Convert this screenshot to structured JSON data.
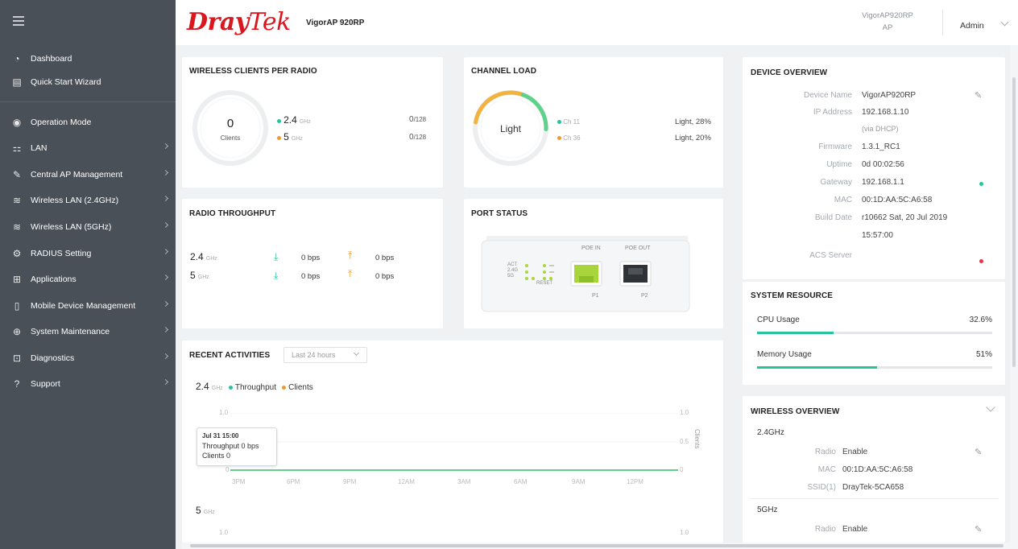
{
  "sidebar": {
    "items": [
      {
        "label": "Dashboard",
        "icon": "dashboard-icon"
      },
      {
        "label": "Quick Start Wizard",
        "icon": "wizard-icon"
      },
      {
        "label": "Operation Mode",
        "icon": "operation-mode-icon"
      },
      {
        "label": "LAN",
        "icon": "lan-icon"
      },
      {
        "label": "Central AP Management",
        "icon": "wrench-icon"
      },
      {
        "label": "Wireless LAN (2.4GHz)",
        "icon": "wifi-icon"
      },
      {
        "label": "Wireless LAN (5GHz)",
        "icon": "wifi-icon"
      },
      {
        "label": "RADIUS Setting",
        "icon": "gear-icon"
      },
      {
        "label": "Applications",
        "icon": "applications-icon"
      },
      {
        "label": "Mobile Device Management",
        "icon": "mobile-icon"
      },
      {
        "label": "System Maintenance",
        "icon": "maintenance-icon"
      },
      {
        "label": "Diagnostics",
        "icon": "diagnostics-icon"
      },
      {
        "label": "Support",
        "icon": "help-icon"
      }
    ]
  },
  "header": {
    "logo_dray": "Dray",
    "logo_tek": "Tek",
    "model": "VigorAP 920RP",
    "device_name": "VigorAP920RP",
    "device_mode": "AP",
    "user": "Admin"
  },
  "wireless_clients": {
    "title": "WIRELESS CLIENTS PER RADIO",
    "total": "0",
    "total_label": "Clients",
    "band24": "2.4",
    "band5": "5",
    "ghz": "GHz",
    "count24": "0",
    "max24": "/128",
    "count5": "0",
    "max5": "/128"
  },
  "channel_load": {
    "title": "CHANNEL LOAD",
    "center": "Light",
    "ch1": "Ch 11",
    "ch1_load": "Light, 28%",
    "ch2": "Ch 36",
    "ch2_load": "Light, 20%",
    "ch1_percent": 28,
    "ch2_percent": 20
  },
  "device_overview": {
    "title": "DEVICE OVERVIEW",
    "rows": [
      {
        "label": "Device Name",
        "value": "VigorAP920RP"
      },
      {
        "label": "IP Address",
        "value": "192.168.1.10"
      },
      {
        "label": "",
        "value": "(via DHCP)"
      },
      {
        "label": "Firmware",
        "value": "1.3.1_RC1"
      },
      {
        "label": "Uptime",
        "value": "0d 00:02:56"
      },
      {
        "label": "Gateway",
        "value": "192.168.1.1"
      },
      {
        "label": "MAC",
        "value": "00:1D:AA:5C:A6:58"
      },
      {
        "label": "Build Date",
        "value": "r10662 Sat, 20 Jul 2019"
      },
      {
        "label": "",
        "value": "15:57:00"
      },
      {
        "label": "ACS Server",
        "value": ""
      }
    ]
  },
  "radio_throughput": {
    "title": "RADIO THROUGHPUT",
    "band24": "2.4",
    "band5": "5",
    "ghz": "GHz",
    "down24": "0 bps",
    "up24": "0 bps",
    "down5": "0 bps",
    "up5": "0 bps"
  },
  "port_status": {
    "title": "PORT STATUS",
    "poe_in": "POE IN",
    "poe_out": "POE OUT",
    "p1": "P1",
    "p2": "P2",
    "act": "ACT",
    "g24": "2.4G",
    "g5": "5G",
    "reset": "RESET"
  },
  "system_resource": {
    "title": "SYSTEM RESOURCE",
    "cpu_label": "CPU Usage",
    "cpu_value": "32.6%",
    "cpu_fraction": 0.326,
    "mem_label": "Memory Usage",
    "mem_value": "51%",
    "mem_fraction": 0.51
  },
  "recent": {
    "title": "RECENT ACTIVITIES",
    "range": "Last 24 hours",
    "band24": "2.4",
    "band5": "5",
    "ghz": "GHz",
    "legend_throughput": "Throughput",
    "legend_clients": "Clients",
    "y_left_top": "1.0",
    "y_left_bottom": "0",
    "y_right_top": "1.0",
    "y_right_mid": "0.5",
    "y_right_bottom": "0",
    "y_right_label": "Clients",
    "x_ticks": [
      "3PM",
      "6PM",
      "9PM",
      "12AM",
      "3AM",
      "6AM",
      "9AM",
      "12PM"
    ],
    "tooltip_time": "Jul 31 15:00",
    "tooltip_throughput": "Throughput  0 bps",
    "tooltip_clients": "Clients  0",
    "chart5_left_top": "1.0",
    "chart5_right_top": "1.0"
  },
  "wireless_overview": {
    "title": "WIRELESS OVERVIEW",
    "band24": "2.4GHz",
    "radio_label": "Radio",
    "radio24": "Enable",
    "mac_label": "MAC",
    "mac24": "00:1D:AA:5C:A6:58",
    "ssid_label": "SSID(1)",
    "ssid24": "DrayTek-5CA658",
    "band5": "5GHz",
    "radio5": "Enable"
  },
  "colors": {
    "brand": "#d8171e",
    "green": "#27c39a",
    "orange": "#f09a2a",
    "status_red": "#e8334a"
  }
}
